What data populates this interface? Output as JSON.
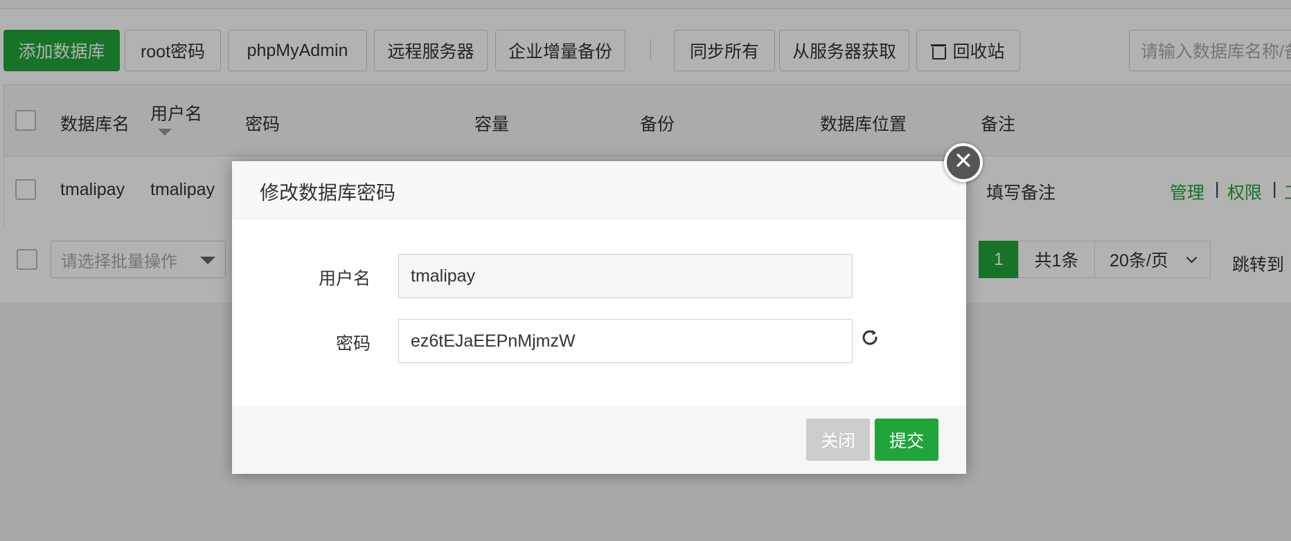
{
  "toolbar": {
    "add_database": "添加数据库",
    "root_password": "root密码",
    "phpmyadmin": "phpMyAdmin",
    "remote_server": "远程服务器",
    "enterprise_backup": "企业增量备份",
    "sync_all": "同步所有",
    "fetch_from_server": "从服务器获取",
    "recycle_bin": "回收站",
    "search_placeholder": "请输入数据库名称/备"
  },
  "table": {
    "headers": {
      "db_name": "数据库名",
      "username": "用户名",
      "password": "密码",
      "capacity": "容量",
      "backup": "备份",
      "location": "数据库位置",
      "note": "备注"
    },
    "rows": [
      {
        "db_name": "tmalipay",
        "username": "tmalipay",
        "note": "填写备注",
        "actions": [
          "管理",
          "权限",
          "工"
        ]
      }
    ],
    "action_separator": "|"
  },
  "footer": {
    "batch_placeholder": "请选择批量操作",
    "current_page": "1",
    "total": "共1条",
    "page_size": "20条/页",
    "jump_to": "跳转到"
  },
  "modal": {
    "title": "修改数据库密码",
    "close_symbol": "✕",
    "username_label": "用户名",
    "username_value": "tmalipay",
    "password_label": "密码",
    "password_value": "ez6tEJaEEPnMjmzW",
    "close_button": "关闭",
    "submit_button": "提交"
  },
  "colors": {
    "primary_green": "#20a53a",
    "disabled_gray": "#cccccc"
  }
}
